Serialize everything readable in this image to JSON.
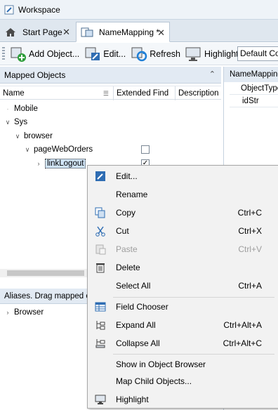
{
  "workspace": {
    "title": "Workspace"
  },
  "tabs": [
    {
      "label": "Start Page"
    },
    {
      "label": "NameMapping *"
    }
  ],
  "toolbar": {
    "add_object": "Add Object...",
    "edit": "Edit...",
    "refresh": "Refresh",
    "highlight": "Highlight",
    "combo_value": "Default Co"
  },
  "mapped_objects": {
    "title": "Mapped Objects",
    "columns": [
      "Name",
      "Extended Find",
      "Description"
    ],
    "tree": [
      {
        "label": "Mobile"
      },
      {
        "label": "Sys"
      },
      {
        "label": "browser"
      },
      {
        "label": "pageWebOrders"
      },
      {
        "label": "linkLogout"
      }
    ]
  },
  "aliases": {
    "title": "Aliases. Drag mapped obj",
    "tree": [
      {
        "label": "Browser"
      }
    ]
  },
  "right_panel": {
    "title": "NameMappinc",
    "rows": [
      "ObjectType",
      "idStr"
    ]
  },
  "context_menu": {
    "items": [
      {
        "label": "Edit...",
        "shortcut": ""
      },
      {
        "label": "Rename",
        "shortcut": ""
      },
      {
        "label": "Copy",
        "shortcut": "Ctrl+C"
      },
      {
        "label": "Cut",
        "shortcut": "Ctrl+X"
      },
      {
        "label": "Paste",
        "shortcut": "Ctrl+V"
      },
      {
        "label": "Delete",
        "shortcut": ""
      },
      {
        "label": "Select All",
        "shortcut": "Ctrl+A"
      },
      {
        "label": "Field Chooser",
        "shortcut": ""
      },
      {
        "label": "Expand All",
        "shortcut": "Ctrl+Alt+A"
      },
      {
        "label": "Collapse All",
        "shortcut": "Ctrl+Alt+C"
      },
      {
        "label": "Show in Object Browser",
        "shortcut": ""
      },
      {
        "label": "Map Child Objects...",
        "shortcut": ""
      },
      {
        "label": "Highlight",
        "shortcut": ""
      }
    ]
  },
  "colors": {
    "accent_highlight_border": "#f08a1d",
    "selection_bg": "#cfe3f6"
  }
}
